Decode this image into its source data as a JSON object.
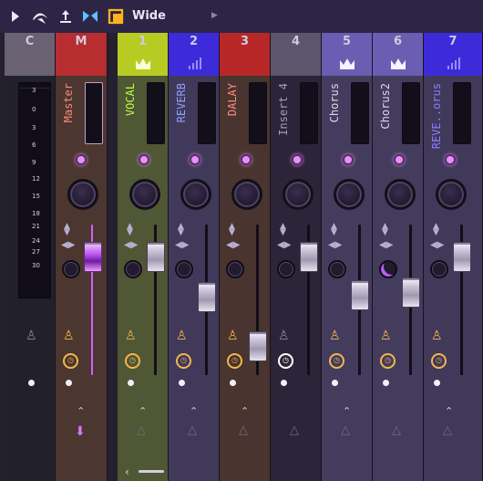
{
  "toolbar": {
    "title": "Wide",
    "icons": [
      "play-arrow-icon",
      "tilt-eye-icon",
      "arrow-up-pin-icon",
      "bowtie-icon",
      "window-square-icon",
      "dropdown-arrow-icon"
    ]
  },
  "strips": [
    {
      "header": "C",
      "name": "",
      "color": "#6a6273",
      "badge": "none"
    },
    {
      "header": "M",
      "name": "Master",
      "color": "#b72d30",
      "badge": "none"
    },
    {
      "header": "1",
      "name": "VOCAL",
      "color": "#b7cb23",
      "badge": "crown"
    },
    {
      "header": "2",
      "name": "REVERB",
      "color": "#3d2bd9",
      "badge": "bars"
    },
    {
      "header": "3",
      "name": "DALAY",
      "color": "#b82727",
      "badge": "none"
    },
    {
      "header": "4",
      "name": "Insert 4",
      "color": "#5d546d",
      "badge": "none"
    },
    {
      "header": "5",
      "name": "Chorus",
      "color": "#6b5db2",
      "badge": "crown"
    },
    {
      "header": "6",
      "name": "Chorus2",
      "color": "#6b5db2",
      "badge": "crown"
    },
    {
      "header": "7",
      "name": "REVE..orus",
      "color": "#3d2bd9",
      "badge": "bars"
    }
  ],
  "scale_ticks": [
    "3",
    "0",
    "3",
    "6",
    "9",
    "12",
    "15",
    "18",
    "21",
    "24",
    "27",
    "30"
  ],
  "name_colors": {
    "master": "#fa887a",
    "vocal": "#b9ff46",
    "reverb": "#8ea2ff",
    "dalay": "#ff8a79",
    "insert": "#a59db3",
    "chorus": "#dcd7f0",
    "chorus2": "#dcd7f0",
    "reve": "#8b7cff"
  },
  "fader_levels": {
    "master": "high",
    "vocal": "high",
    "reverb": "mid",
    "dalay": "low",
    "insert": "high",
    "chorus": "mid",
    "chorus2": "mid",
    "reve": "high"
  }
}
